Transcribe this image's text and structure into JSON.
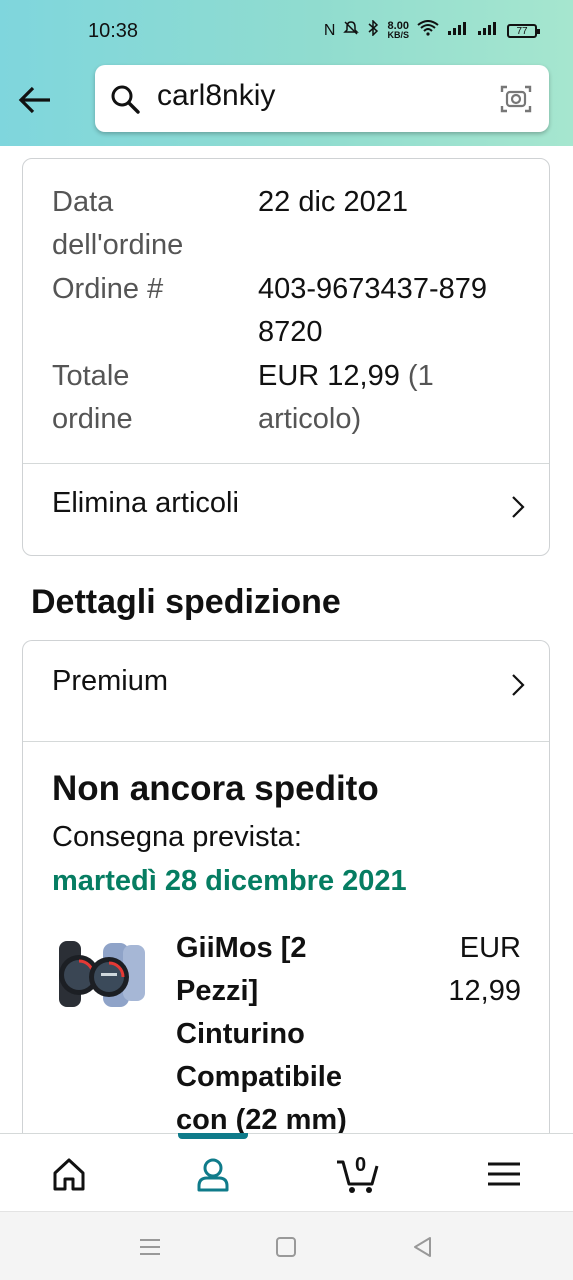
{
  "status_bar": {
    "time": "10:38",
    "net_speed_value": "8.00",
    "net_speed_unit": "KB/S",
    "battery": "77"
  },
  "search": {
    "query": "carl8nkiy"
  },
  "order_summary": {
    "date_label": "Data dell'ordine",
    "date_value": "22 dic 2021",
    "order_label": "Ordine #",
    "order_value": "403-9673437-8798720",
    "total_label": "Totale ordine",
    "total_value": "EUR 12,99",
    "total_count": "(1 articolo)",
    "delete_label": "Elimina articoli"
  },
  "shipping": {
    "section_title": "Dettagli spedizione",
    "plan_label": "Premium",
    "status_title": "Non ancora spedito",
    "delivery_label": "Consegna prevista:",
    "delivery_date": "martedì 28 dicembre 2021"
  },
  "product": {
    "name": "GiiMos [2 Pezzi] Cinturino Compatibile con (22 mm)",
    "price": "EUR 12,99"
  },
  "bottom_nav": {
    "cart_count": "0",
    "items": [
      "home-icon",
      "account-icon",
      "cart-icon",
      "menu-icon"
    ]
  },
  "colors": {
    "accent": "#0f7b8a",
    "delivery_green": "#067d62"
  }
}
